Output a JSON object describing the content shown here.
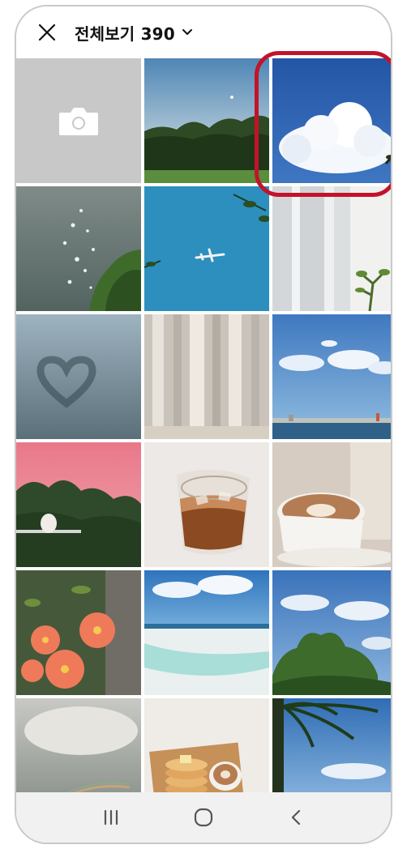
{
  "header": {
    "close_icon": "close-icon",
    "title": "전체보기 390",
    "dropdown_icon": "chevron-down-icon"
  },
  "grid": {
    "camera_tile_icon": "camera-icon",
    "photos": [
      "sky-moon-trees",
      "white-cloud-blue-sky",
      "sparkling-water",
      "airplane-blue-sky",
      "white-curtain-plant",
      "heart-on-foggy-glass",
      "sunlit-curtain",
      "sea-clouds-island",
      "pink-sky-trees",
      "iced-coffee",
      "latte-cup",
      "orange-flowers",
      "white-beach",
      "tree-blue-sky",
      "rainbow-clouds",
      "pancakes-latte",
      "palm-tree-sky"
    ]
  },
  "navbar": {
    "recents_icon": "recents-icon",
    "home_icon": "home-icon",
    "back_icon": "back-icon"
  },
  "colors": {
    "highlight": "#c3132a",
    "camera_tile": "#c8c8c8"
  }
}
